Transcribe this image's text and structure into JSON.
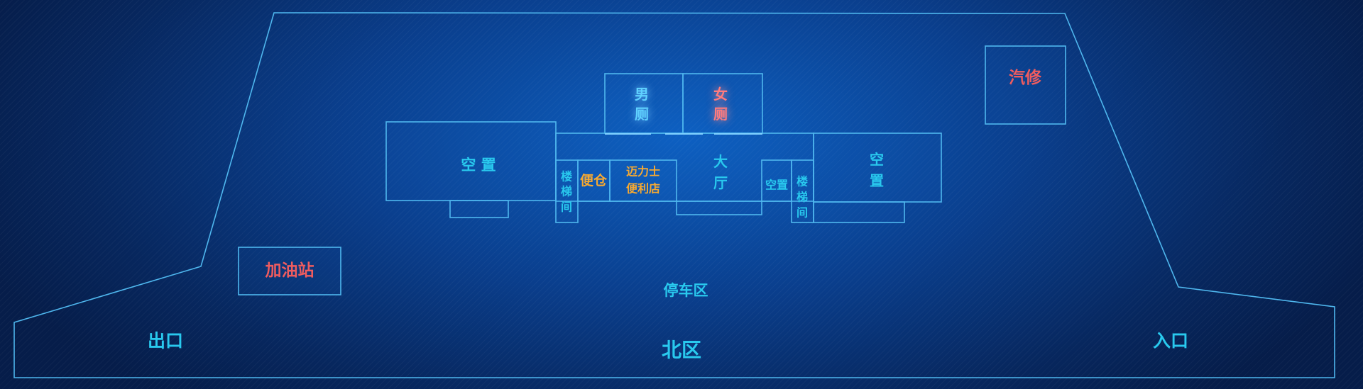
{
  "colors": {
    "background": "#0a3f8e",
    "outline": "#4fb7ee",
    "label_primary": "#29c9ee",
    "label_shop": "#f6a932",
    "label_service": "#ef5c5f"
  },
  "zone": {
    "name": "北区"
  },
  "parking": {
    "label": "停车区"
  },
  "gates": {
    "exit": "出口",
    "entrance": "入口"
  },
  "services": {
    "gas_station": "加油站",
    "auto_repair": "汽修"
  },
  "building": {
    "vacant_left": "空 置",
    "stair_left": [
      "楼",
      "梯",
      "间"
    ],
    "storage": "便仓",
    "store": [
      "迈力士",
      "便利店"
    ],
    "hall": [
      "大",
      "厅"
    ],
    "vacant_small": "空置",
    "stair_right": [
      "楼",
      "梯",
      "间"
    ],
    "vacant_right": [
      "空",
      "置"
    ],
    "men_restroom": [
      "男",
      "厕"
    ],
    "women_restroom": [
      "女",
      "厕"
    ]
  }
}
